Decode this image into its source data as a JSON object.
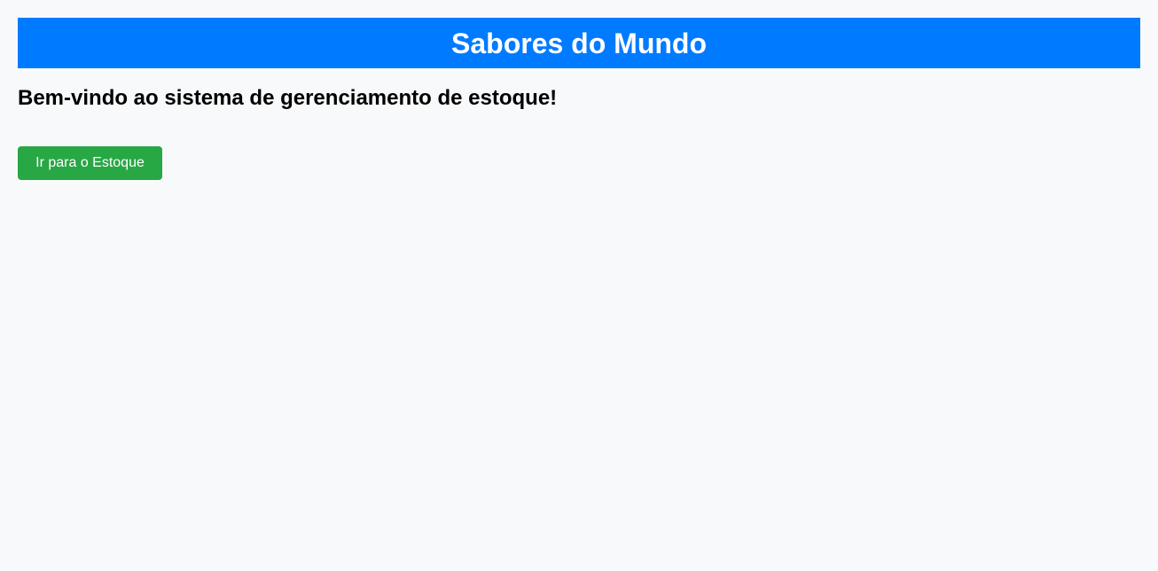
{
  "header": {
    "title": "Sabores do Mundo"
  },
  "main": {
    "welcome_text": "Bem-vindo ao sistema de gerenciamento de estoque!",
    "go_to_stock_label": "Ir para o Estoque"
  },
  "colors": {
    "header_bg": "#007bff",
    "button_bg": "#28a745",
    "page_bg": "#f8f9fa"
  }
}
